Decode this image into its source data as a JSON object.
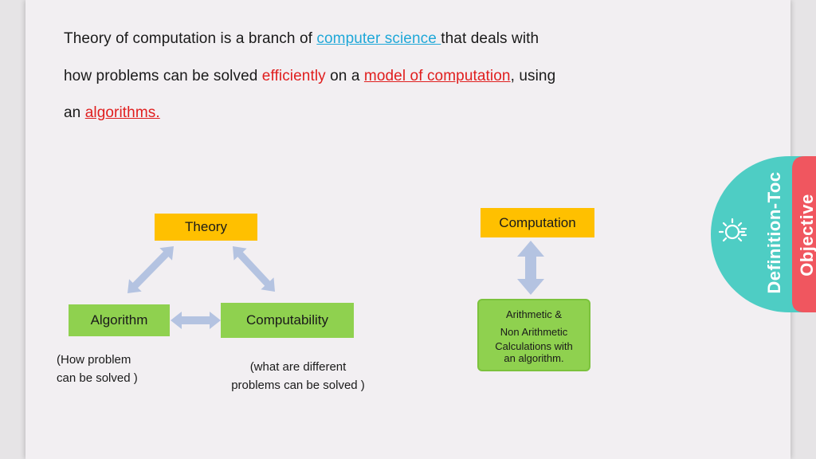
{
  "paragraph": {
    "line1": {
      "prefix": "Theory of computation is a branch of ",
      "link": "computer science ",
      "suffix": "that deals with"
    },
    "line2": {
      "prefix": "how problems can be solved ",
      "emphasis": "efficiently",
      "middle": " on a ",
      "link": "model of computation",
      "suffix": ", using"
    },
    "line3": {
      "prefix": "an ",
      "link": "algorithms."
    }
  },
  "diagram": {
    "theory": "Theory",
    "algorithm": "Algorithm",
    "computability": "Computability",
    "algorithm_note": {
      "line1": "(How problem",
      "line2": "can be solved )"
    },
    "computability_note": {
      "line1": "(what are different",
      "line2": "problems can be solved )"
    },
    "computation": "Computation",
    "arithmetic": {
      "line1": "Arithmetic &",
      "line2": "Non Arithmetic",
      "line3": "Calculations with",
      "line4": "an algorithm."
    }
  },
  "side_tabs": {
    "definition": "Definition-Toc",
    "objective": "Objective",
    "icon": "lightbulb-icon"
  },
  "colors": {
    "yellow_box": "#ffc000",
    "green_box": "#8fd14f",
    "arrow": "#b4c3e1",
    "teal_tab": "#4ecdc4",
    "red_tab": "#f0565f",
    "link_blue": "#20a8d8",
    "emphasis_red": "#e01e1e"
  }
}
